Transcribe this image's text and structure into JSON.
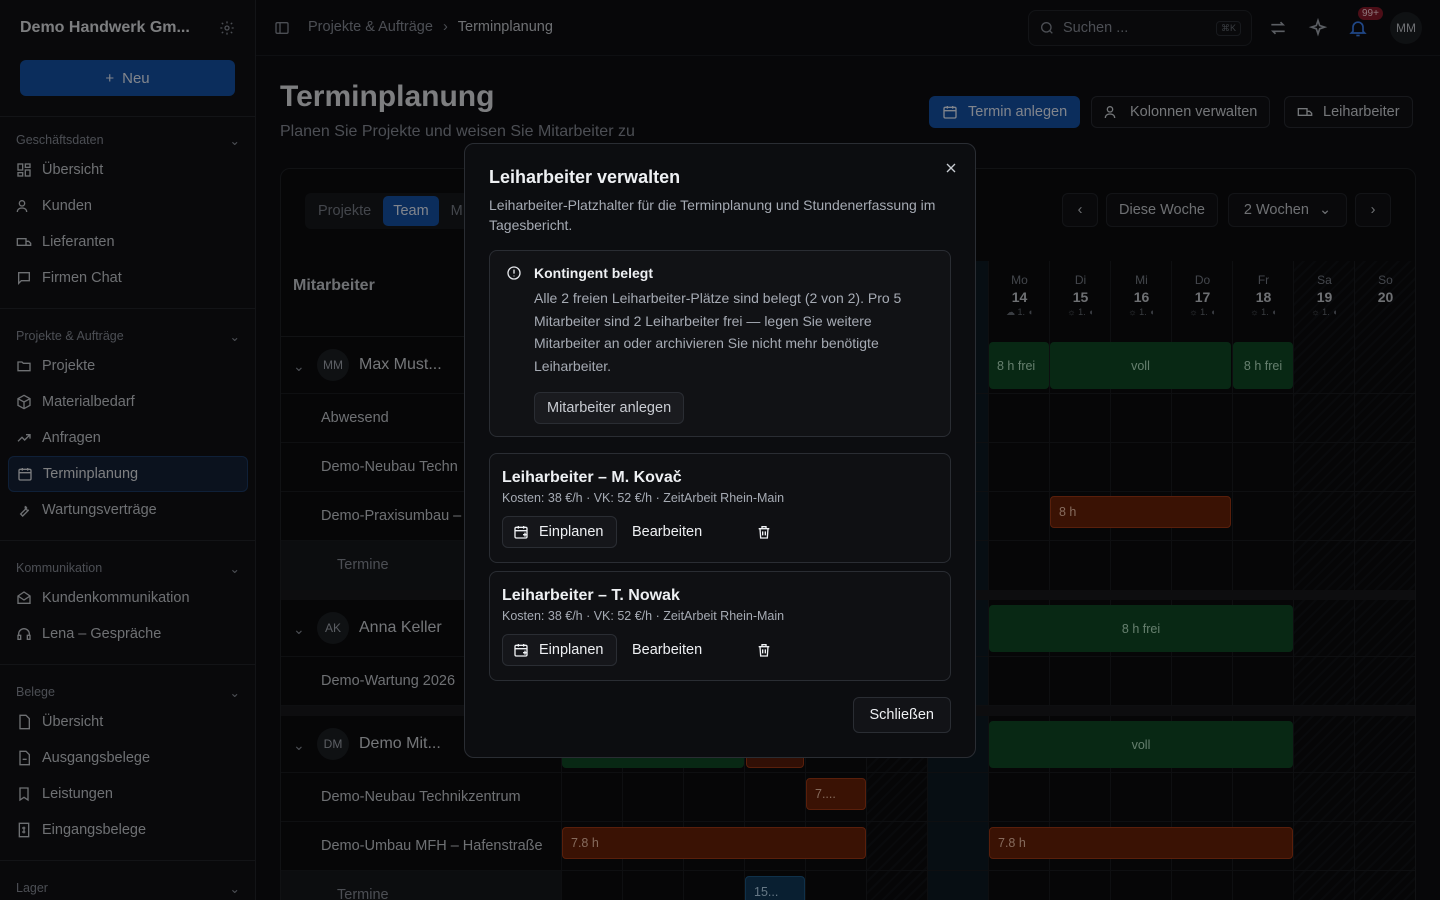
{
  "sidebar": {
    "company": "Demo Handwerk Gm...",
    "new_label": "Neu",
    "sections": [
      {
        "title": "Geschäftsdaten",
        "items": [
          {
            "label": "Übersicht",
            "icon": "dashboard-icon"
          },
          {
            "label": "Kunden",
            "icon": "users-icon"
          },
          {
            "label": "Lieferanten",
            "icon": "truck-icon"
          },
          {
            "label": "Firmen Chat",
            "icon": "chat-icon"
          }
        ]
      },
      {
        "title": "Projekte & Aufträge",
        "items": [
          {
            "label": "Projekte",
            "icon": "folder-icon"
          },
          {
            "label": "Materialbedarf",
            "icon": "package-icon"
          },
          {
            "label": "Anfragen",
            "icon": "trend-icon"
          },
          {
            "label": "Terminplanung",
            "icon": "calendar-icon",
            "active": true
          },
          {
            "label": "Wartungsverträge",
            "icon": "wrench-icon"
          }
        ]
      },
      {
        "title": "Kommunikation",
        "items": [
          {
            "label": "Kundenkommunikation",
            "icon": "mail-icon"
          },
          {
            "label": "Lena – Gespräche",
            "icon": "headset-icon"
          }
        ]
      },
      {
        "title": "Belege",
        "items": [
          {
            "label": "Übersicht",
            "icon": "file-icon"
          },
          {
            "label": "Ausgangsbelege",
            "icon": "file-out-icon"
          },
          {
            "label": "Leistungen",
            "icon": "bookmark-icon"
          },
          {
            "label": "Eingangsbelege",
            "icon": "receipt-icon"
          }
        ]
      },
      {
        "title": "Lager",
        "items": []
      }
    ]
  },
  "header": {
    "breadcrumb_parent": "Projekte & Aufträge",
    "breadcrumb_current": "Terminplanung",
    "search_placeholder": "Suchen ...",
    "search_shortcut": "⌘K",
    "notifications_count": "99+",
    "user_initials": "MM"
  },
  "page": {
    "title": "Terminplanung",
    "subtitle": "Planen Sie Projekte und weisen Sie Mitarbeiter zu",
    "actions": {
      "create": "Termin anlegen",
      "columns": "Kolonnen verwalten",
      "temp": "Leiharbeiter"
    }
  },
  "planner": {
    "view_tabs": [
      "Projekte",
      "Team",
      "M"
    ],
    "active_tab": "Team",
    "this_week": "Diese Woche",
    "range": "2 Wochen",
    "column_header": "Mitarbeiter",
    "days": [
      {
        "wd": "Mo",
        "num": "14",
        "meta": "☁ 1. ◖"
      },
      {
        "wd": "Di",
        "num": "15",
        "meta": "☼ 1. ◖"
      },
      {
        "wd": "Mi",
        "num": "16",
        "meta": "☼ 1. ◖"
      },
      {
        "wd": "Do",
        "num": "17",
        "meta": "☼ 1. ◖"
      },
      {
        "wd": "Fr",
        "num": "18",
        "meta": "☼ 1. ◖"
      },
      {
        "wd": "Sa",
        "num": "19",
        "meta": "☼ 1. ◖"
      },
      {
        "wd": "So",
        "num": "20",
        "meta": ""
      }
    ],
    "groups": [
      {
        "initials": "MM",
        "name": "Max Must...",
        "rows": [
          "Abwesend",
          "Demo-Neubau Techn",
          "Demo-Praxisumbau –"
        ],
        "termine": "Termine"
      },
      {
        "initials": "AK",
        "name": "Anna Keller",
        "rows": [
          "Demo-Wartung 2026"
        ]
      },
      {
        "initials": "DM",
        "name": "Demo Mit...",
        "rows": [
          "Demo-Neubau Technikzentrum",
          "Demo-Umbau MFH – Hafenstraße"
        ],
        "termine": "Termine"
      }
    ],
    "bars": {
      "b1": "8 h frei",
      "b2": "voll",
      "b3": "8 h frei",
      "b4": "8 h",
      "b5": "8 h frei",
      "b6": "voll",
      "b7": "7....",
      "b8": "7.8 h",
      "b9": "7.8 h",
      "b10": "15..."
    }
  },
  "modal": {
    "title": "Leiharbeiter verwalten",
    "description": "Leiharbeiter-Platzhalter für die Terminplanung und Stundenerfassung im Tagesbericht.",
    "alert_title": "Kontingent belegt",
    "alert_text": "Alle 2 freien Leiharbeiter-Plätze sind belegt (2 von 2). Pro 5 Mitarbeiter sind 2 Leiharbeiter frei — legen Sie weitere Mitarbeiter an oder archivieren Sie nicht mehr benötigte Leiharbeiter.",
    "alert_button": "Mitarbeiter anlegen",
    "workers": [
      {
        "name": "Leiharbeiter – M. Kovač",
        "details": "Kosten: 38 €/h · VK: 52 €/h · ZeitArbeit Rhein-Main"
      },
      {
        "name": "Leiharbeiter – T. Nowak",
        "details": "Kosten: 38 €/h · VK: 52 €/h · ZeitArbeit Rhein-Main"
      }
    ],
    "schedule_label": "Einplanen",
    "edit_label": "Bearbeiten",
    "close_label": "Schließen"
  }
}
